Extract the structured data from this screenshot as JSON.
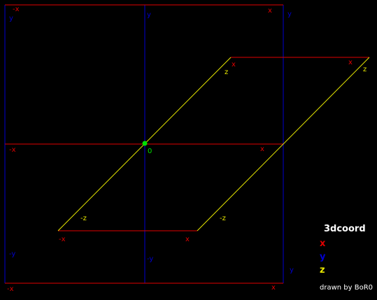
{
  "colors": {
    "background": "#000000",
    "x_axis": "#e00000",
    "y_axis": "#0000d0",
    "z_axis": "#e8e800",
    "origin": "#00e000",
    "text": "#ffffff"
  },
  "labels": {
    "x": "x",
    "neg_x": "-x",
    "y": "y",
    "neg_y": "-y",
    "z": "z",
    "neg_z": "-z",
    "origin": "0"
  },
  "legend": {
    "title": "3dcoord",
    "x": "x",
    "y": "y",
    "z": "z"
  },
  "credit": "drawn by BoR0"
}
